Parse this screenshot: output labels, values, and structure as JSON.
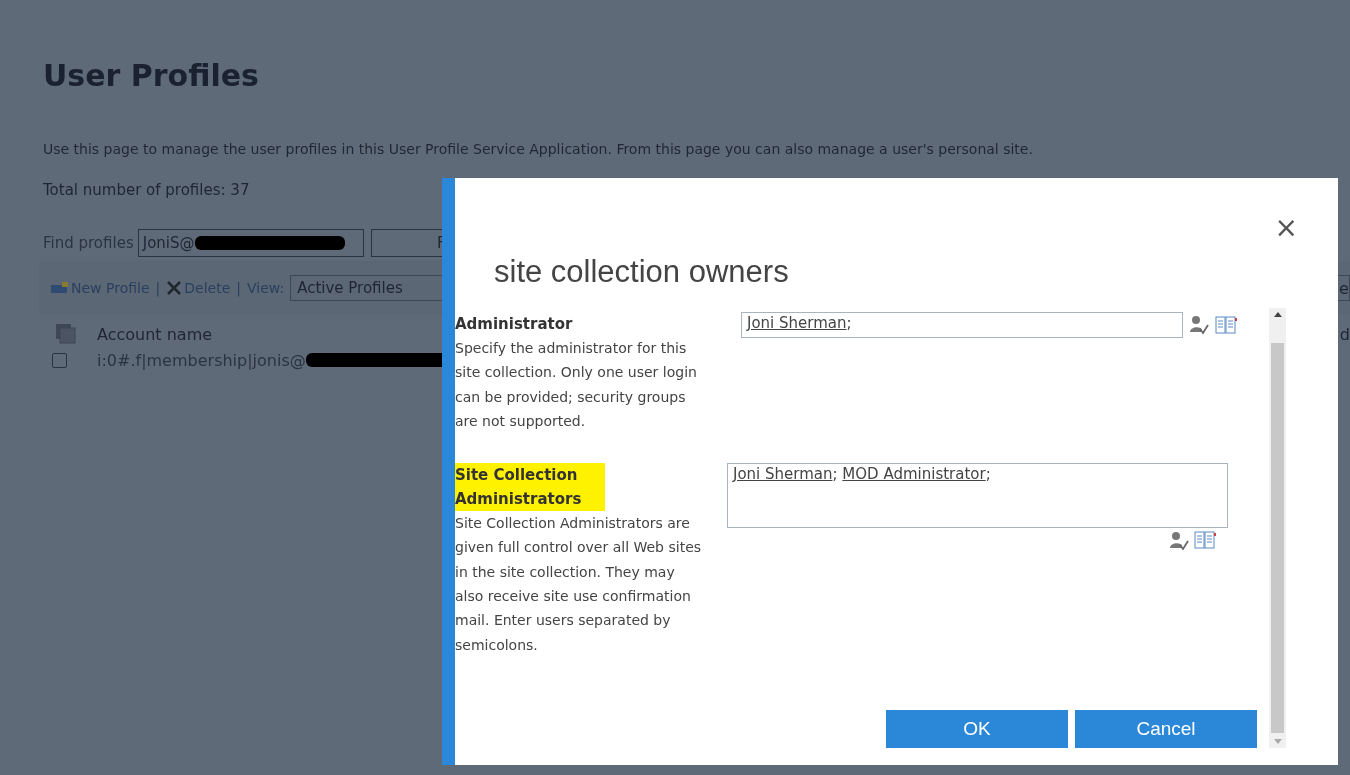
{
  "page": {
    "title": "User Profiles",
    "description": "Use this page to manage the user profiles in this User Profile Service Application. From this page you can also manage a user's personal site.",
    "total": "Total number of profiles: 37",
    "find_label": "Find profiles",
    "find_value": "JoniS@",
    "find_button": "F",
    "toolbar": [
      {
        "kind": "new",
        "label": "New Profile"
      },
      {
        "kind": "sep",
        "label": "|"
      },
      {
        "kind": "delete",
        "label": "Delete"
      },
      {
        "kind": "sep",
        "label": "|"
      },
      {
        "kind": "label",
        "label": "View:"
      }
    ],
    "view_value": "Active Profiles",
    "right_button": "e",
    "table": {
      "columns": [
        "Account name",
        "d"
      ],
      "rows": [
        {
          "checked": false,
          "account": "i:0#.f|membership|jonis@"
        }
      ]
    }
  },
  "dialog": {
    "title": "site collection owners",
    "close": "×",
    "sections": [
      {
        "label": "Administrator",
        "highlighted": false,
        "description": "Specify the administrator for this site collection. Only one user login can be provided; security groups are not supported.",
        "kind": "single",
        "separator": ";",
        "people": [
          "Joni Sherman"
        ]
      },
      {
        "label": "Site Collection Administrators",
        "highlighted": true,
        "description": "Site Collection Administrators are given full control over all Web sites in the site collection. They may also receive site use confirmation mail. Enter users separated by semicolons.",
        "kind": "multi",
        "separator": ";",
        "people": [
          "Joni Sherman",
          "MOD Administrator"
        ]
      }
    ],
    "buttons": [
      "OK",
      "Cancel"
    ]
  }
}
